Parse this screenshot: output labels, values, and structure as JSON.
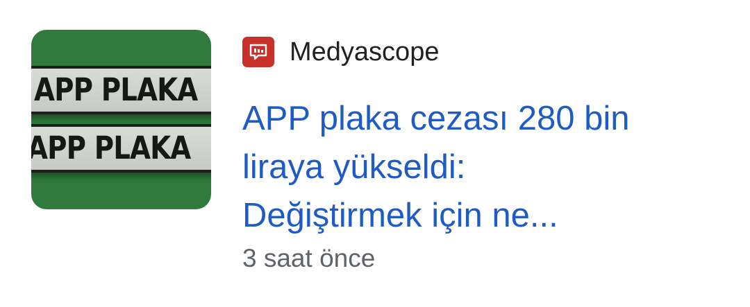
{
  "article": {
    "thumbnail": {
      "plate_top_text": "APP PLAKA",
      "plate_bottom_text": "APP PLAKA",
      "background_color": "#2f7a3c"
    },
    "source": {
      "icon": "medyascope-logo-icon",
      "icon_color": "#c8302b",
      "name": "Medyascope"
    },
    "headline_lines": [
      "APP plaka cezası 280 bin",
      "liraya yükseldi:",
      "Değiştirmek için ne..."
    ],
    "time": "3 saat önce",
    "headline_color": "#1f5bc4"
  }
}
